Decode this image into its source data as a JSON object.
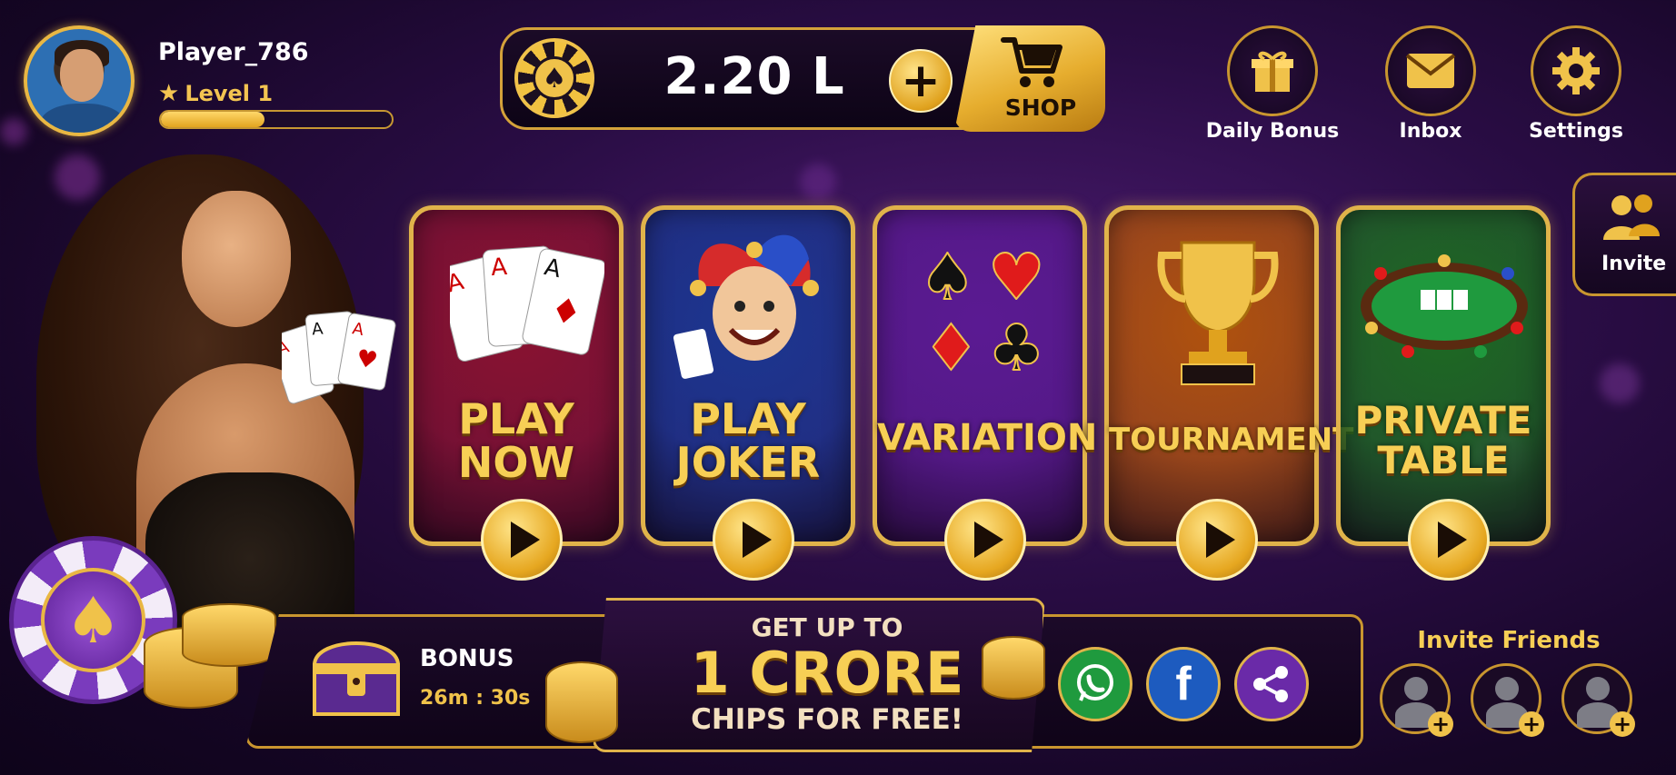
{
  "player": {
    "name": "Player_786",
    "level_label": "Level 1",
    "xp_progress": 0.45,
    "avatar_icon": "player-avatar"
  },
  "wallet": {
    "amount": "2.20 L",
    "chip_icon": "spade-chip-icon",
    "add_icon": "plus-icon",
    "shop_label": "SHOP",
    "shop_icon": "cart-icon"
  },
  "top_actions": [
    {
      "label": "Daily Bonus",
      "icon": "gift-icon"
    },
    {
      "label": "Inbox",
      "icon": "mail-icon"
    },
    {
      "label": "Settings",
      "icon": "gear-icon"
    }
  ],
  "side_invite": {
    "label": "Invite",
    "icon": "users-icon"
  },
  "game_modes": [
    {
      "title_lines": [
        "PLAY",
        "NOW"
      ],
      "color": "#8a1230",
      "art": "playing-cards-icon"
    },
    {
      "title_lines": [
        "PLAY",
        "JOKER"
      ],
      "color": "#1b3690",
      "art": "joker-icon"
    },
    {
      "title_lines": [
        "VARIATION"
      ],
      "color": "#5a1a92",
      "art": "card-suits-icon"
    },
    {
      "title_lines": [
        "TOURNAMENT"
      ],
      "color": "#b0520d",
      "art": "trophy-icon"
    },
    {
      "title_lines": [
        "PRIVATE",
        "TABLE"
      ],
      "color": "#1d6a22",
      "art": "poker-table-icon"
    }
  ],
  "bonus": {
    "label": "BONUS",
    "timer": "26m : 30s",
    "icon": "treasure-chest-icon"
  },
  "promo": {
    "line1": "GET UP TO",
    "line2": "1 CRORE",
    "line3": "CHIPS FOR FREE!"
  },
  "share": [
    {
      "name": "whatsapp",
      "icon": "whatsapp-icon",
      "color": "#1f9a3e"
    },
    {
      "name": "facebook",
      "icon": "facebook-icon",
      "color": "#1d5bbf"
    },
    {
      "name": "share",
      "icon": "share-icon",
      "color": "#6a2aa8"
    }
  ],
  "invite_friends": {
    "label": "Invite Friends",
    "slots": 3
  }
}
